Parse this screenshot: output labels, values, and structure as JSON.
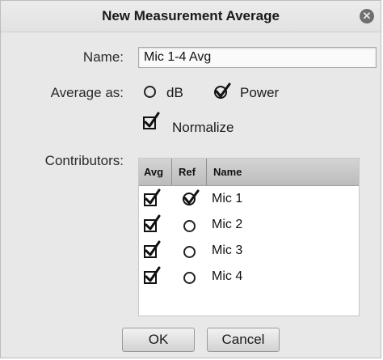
{
  "dialog": {
    "title": "New Measurement Average",
    "close_icon": "close-x-icon"
  },
  "form": {
    "name_label": "Name:",
    "name_value": "Mic 1-4 Avg",
    "average_as_label": "Average as:",
    "average_options": [
      {
        "label": "dB",
        "selected": false
      },
      {
        "label": "Power",
        "selected": true
      }
    ],
    "normalize_label": "Normalize",
    "normalize_checked": true,
    "contributors_label": "Contributors:"
  },
  "contributors": {
    "columns": [
      "Avg",
      "Ref",
      "Name"
    ],
    "rows": [
      {
        "avg": true,
        "ref": true,
        "name": "Mic 1"
      },
      {
        "avg": true,
        "ref": false,
        "name": "Mic 2"
      },
      {
        "avg": true,
        "ref": false,
        "name": "Mic 3"
      },
      {
        "avg": true,
        "ref": false,
        "name": "Mic 4"
      }
    ]
  },
  "buttons": {
    "ok": "OK",
    "cancel": "Cancel"
  }
}
